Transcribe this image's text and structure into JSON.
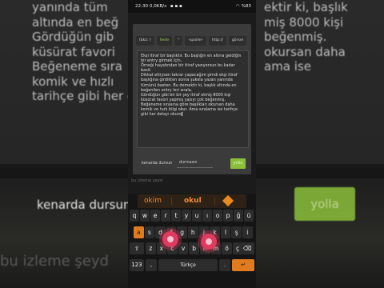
{
  "background": {
    "text_lines": [
      "yanında tüm",
      "altında en beğ",
      "Gördüğün gib",
      "küsürat favori",
      "Beğeneme sıra",
      "komik ve hızlı",
      "tarihçe gibi her detayı okum"
    ],
    "right_lines": [
      "ektir ki, başlık",
      "",
      "miş 8000 kişi",
      "beğenmiş.",
      "okursan daha",
      "ama ise",
      ""
    ],
    "input_text": "kenarda dursun",
    "button_text": "yolla",
    "under_text": "bu izleme şeyd"
  },
  "status_bar": {
    "time": "22:30",
    "speed": "0,0KB/s",
    "battery": "%83"
  },
  "tabs": [
    {
      "label": "(bkz: )"
    },
    {
      "label": "hede"
    },
    {
      "label": "*"
    },
    {
      "label": "-spoiler-"
    },
    {
      "label": "http://"
    },
    {
      "label": "görsel"
    }
  ],
  "entry_text": "Ekşi itiraf bir başlıktır. Bu başlığın en altına geldiğin bir entry girmek için.\nÖrneği hayatından bir itiraf yazıyorsun bu kadar basit.\nDikkat ettiysen tekrar yapacağım şimdi ekşi itiraf başlığına girdikten sonra şukela yazan yanında tümünü basten. Bu demektir ki, başlık altında en beğenilen entry leri sırala.\nGördüğün gibi bir bir şey itiraf etmiş 8000 kişi küsürat favori yapmış yazıyı çok beğenmiş.\nBeğeneme sırasına göre başlıkları okursan daha komik ve hızlı bilgi okur. Ama sıralama ise tarihçe gibi her detayı okum",
  "form": {
    "label": "kenarda dursun",
    "field_value": "durmasın",
    "send_label": "yolla"
  },
  "under_text": "bu izleme şeyd",
  "keyboard": {
    "suggestions": [
      "okim",
      "okul"
    ],
    "rows": [
      [
        "q",
        "w",
        "e",
        "r",
        "t",
        "y",
        "u",
        "ı",
        "o",
        "p",
        "ğ",
        "ü"
      ],
      [
        "a",
        "s",
        "d",
        "f",
        "g",
        "h",
        "j",
        "k",
        "l",
        "ş",
        "i"
      ],
      [
        "z",
        "x",
        "c",
        "v",
        "b",
        "n",
        "m",
        "ö",
        "ç"
      ]
    ],
    "bottom": [
      "123",
      ",",
      "Türkçe",
      ".",
      "↵"
    ],
    "highlighted_key": "a",
    "accent_color": "#e07b1f"
  }
}
